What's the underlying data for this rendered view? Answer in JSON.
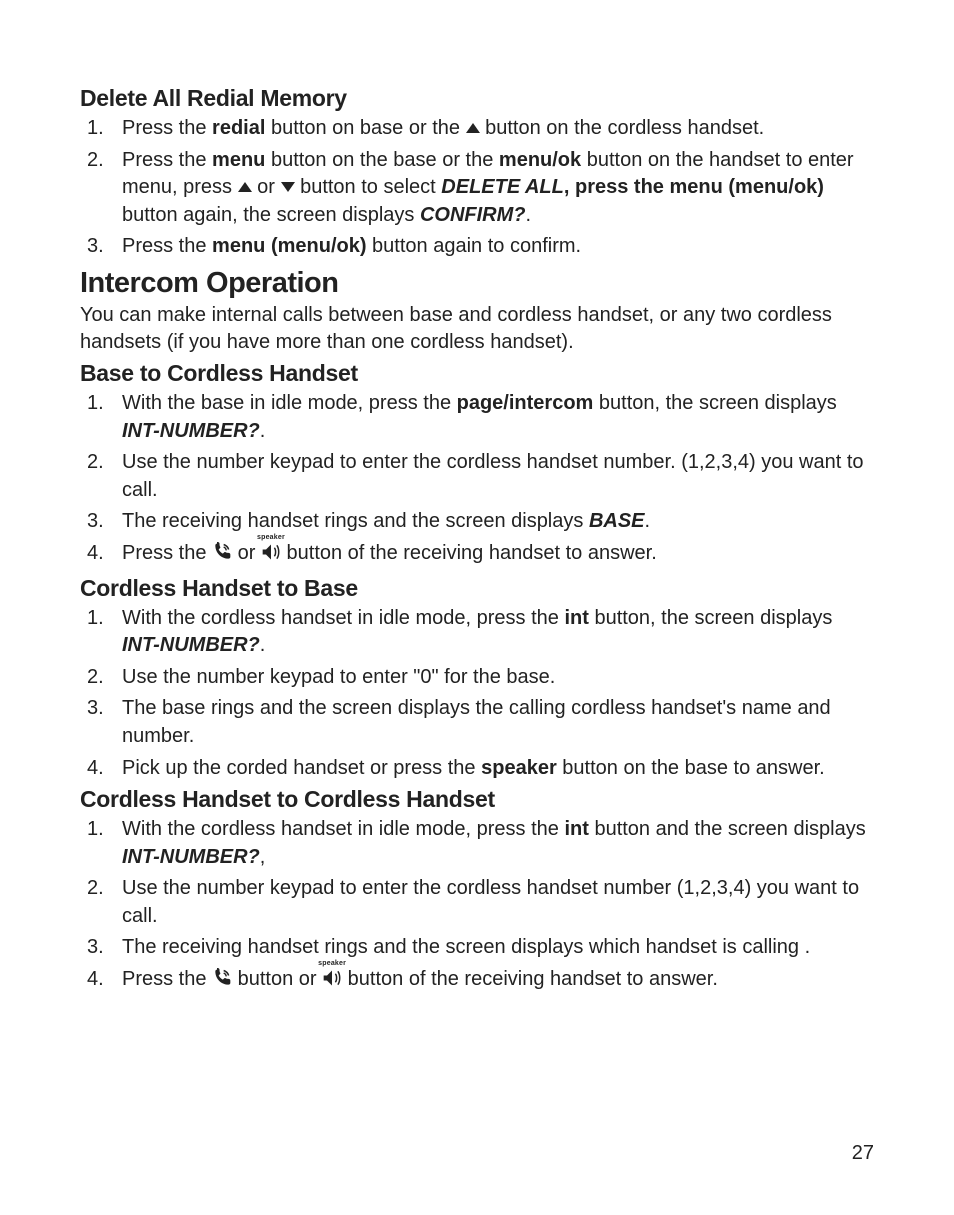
{
  "page_number": "27",
  "section_redial": {
    "heading": "Delete All Redial Memory",
    "items": [
      {
        "a": "Press the ",
        "b": "redial",
        "c": " button on base or the ",
        "d": "",
        "e": " button on the cordless handset."
      },
      {
        "a": "Press the ",
        "b": "menu",
        "c": " button on the base or the ",
        "d": "menu/ok",
        "e": " button on the handset to enter menu, press ",
        "f": " or ",
        "g": " button to select ",
        "h": "DELETE ALL",
        "i": ", press the ",
        "j": "menu (menu/ok)",
        "k": " button again, the screen displays ",
        "l": "CONFIRM?",
        "m": "."
      },
      {
        "a": "Press the ",
        "b": "menu (menu/ok)",
        "c": " button again to confirm."
      }
    ]
  },
  "section_intercom": {
    "heading": "Intercom Operation",
    "intro": "You can make internal calls between base and cordless handset, or any two cordless handsets (if you have more than one cordless handset)."
  },
  "section_base_to": {
    "heading": "Base to Cordless Handset",
    "items": [
      {
        "a": "With the base in idle mode, press the ",
        "b": "page/intercom",
        "c": " button, the screen displays ",
        "d": "INT-NUMBER?",
        "e": "."
      },
      {
        "a": "Use the number keypad to enter the cordless handset number. (1,2,3,4) you want to call."
      },
      {
        "a": "The receiving handset rings and the screen displays ",
        "b": "BASE",
        "c": "."
      },
      {
        "a": "Press the ",
        "b": " or ",
        "c": " button of the receiving handset to answer."
      }
    ]
  },
  "section_handset_to_base": {
    "heading": "Cordless Handset to Base",
    "items": [
      {
        "a": "With the cordless handset in idle mode, press the ",
        "b": "int",
        "c": " button, the screen displays ",
        "d": "INT-NUMBER?",
        "e": "."
      },
      {
        "a": "Use the number keypad to enter \"0\" for the base."
      },
      {
        "a": "The base rings and the screen displays the calling cordless handset's name and number."
      },
      {
        "a": "Pick up the corded handset or press the ",
        "b": "speaker",
        "c": " button on the base to answer."
      }
    ]
  },
  "section_handset_to_handset": {
    "heading": "Cordless Handset to Cordless Handset",
    "items": [
      {
        "a": "With the cordless handset in idle mode, press the ",
        "b": "int",
        "c": " button and the screen displays ",
        "d": "INT-NUMBER?",
        "e": ","
      },
      {
        "a": "Use the number keypad to enter the cordless handset number (1,2,3,4) you want to call."
      },
      {
        "a": "The receiving handset rings and the screen displays which handset is calling ."
      },
      {
        "a": "Press the ",
        "b": " button or ",
        "c": " button of the receiving handset to answer."
      }
    ]
  },
  "speaker_label": "speaker"
}
